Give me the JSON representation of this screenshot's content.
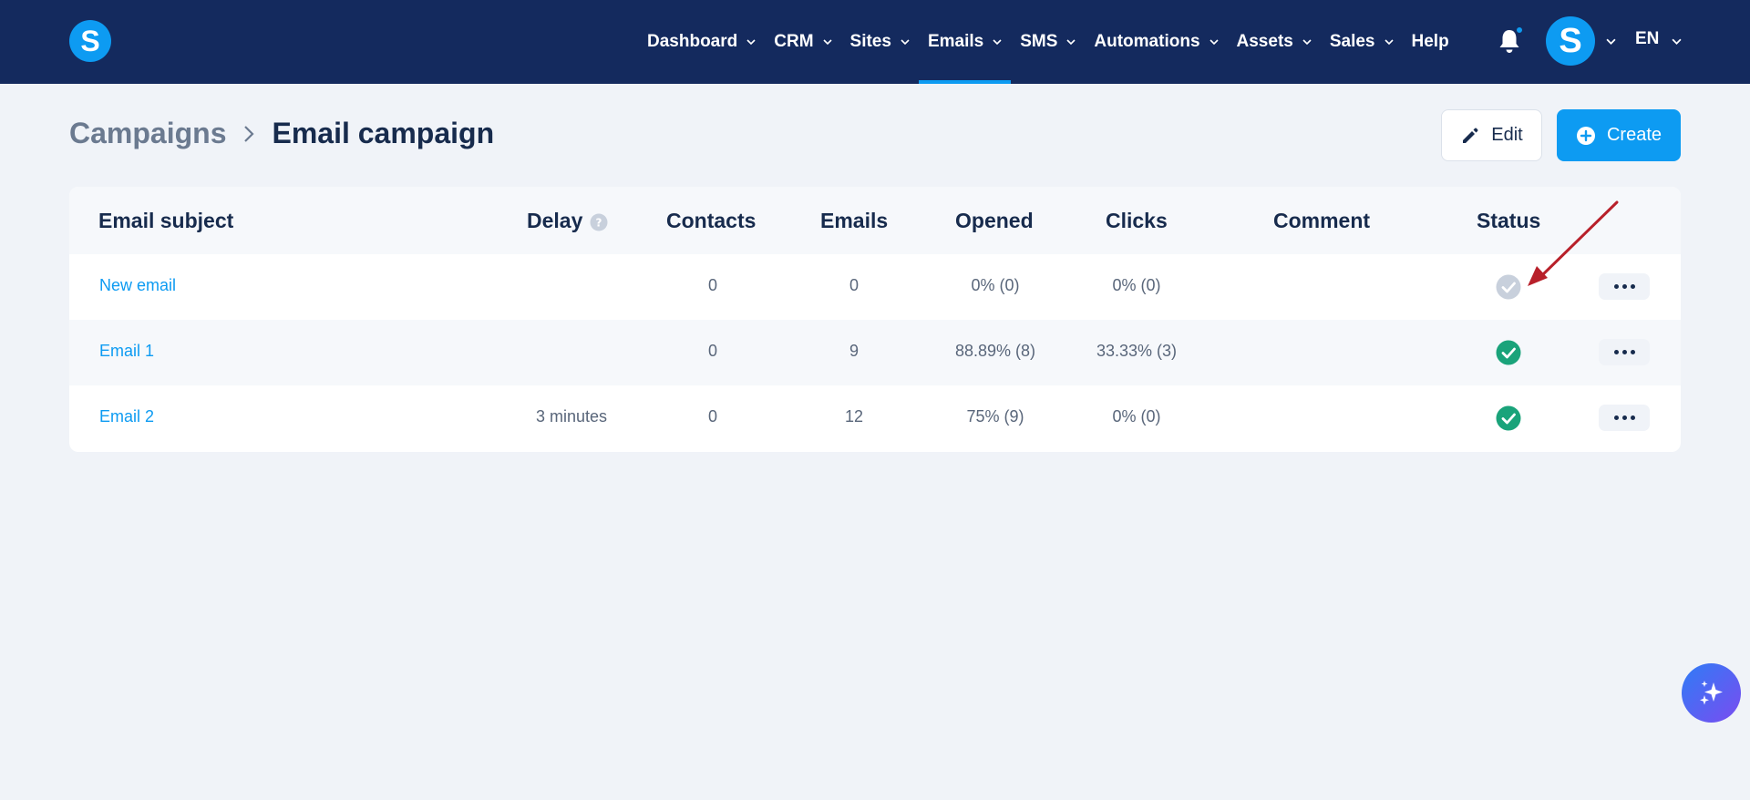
{
  "app": {
    "logo_letter": "S"
  },
  "nav": {
    "items": [
      {
        "label": "Dashboard",
        "has_dropdown": true
      },
      {
        "label": "CRM",
        "has_dropdown": true
      },
      {
        "label": "Sites",
        "has_dropdown": true
      },
      {
        "label": "Emails",
        "has_dropdown": true,
        "active": true
      },
      {
        "label": "SMS",
        "has_dropdown": true
      },
      {
        "label": "Automations",
        "has_dropdown": true
      },
      {
        "label": "Assets",
        "has_dropdown": true
      },
      {
        "label": "Sales",
        "has_dropdown": true
      },
      {
        "label": "Help",
        "has_dropdown": false
      }
    ],
    "avatar_letter": "S",
    "language": "EN"
  },
  "breadcrumb": {
    "parent": "Campaigns",
    "current": "Email campaign"
  },
  "actions": {
    "edit_label": "Edit",
    "create_label": "Create"
  },
  "table": {
    "headers": {
      "subject": "Email subject",
      "delay": "Delay",
      "contacts": "Contacts",
      "emails": "Emails",
      "opened": "Opened",
      "clicks": "Clicks",
      "comment": "Comment",
      "status": "Status"
    },
    "rows": [
      {
        "subject": "New email",
        "delay": "",
        "contacts": "0",
        "emails": "0",
        "opened": "0% (0)",
        "clicks": "0% (0)",
        "comment": "",
        "status": "inactive"
      },
      {
        "subject": "Email 1",
        "delay": "",
        "contacts": "0",
        "emails": "9",
        "opened": "88.89% (8)",
        "clicks": "33.33% (3)",
        "comment": "",
        "status": "active"
      },
      {
        "subject": "Email 2",
        "delay": "3 minutes",
        "contacts": "0",
        "emails": "12",
        "opened": "75% (9)",
        "clicks": "0% (0)",
        "comment": "",
        "status": "active"
      }
    ]
  },
  "colors": {
    "nav_bg": "#142a5e",
    "accent": "#0d9bf2",
    "status_active": "#1aa37a",
    "status_inactive": "#c8d0dc",
    "annotation": "#b8202a"
  },
  "icons": [
    "chevron-down-icon",
    "bell-icon",
    "chevron-right-icon",
    "pencil-icon",
    "plus-circle-icon",
    "help-circle-icon",
    "check-circle-icon",
    "more-horizontal-icon",
    "sparkles-icon"
  ]
}
